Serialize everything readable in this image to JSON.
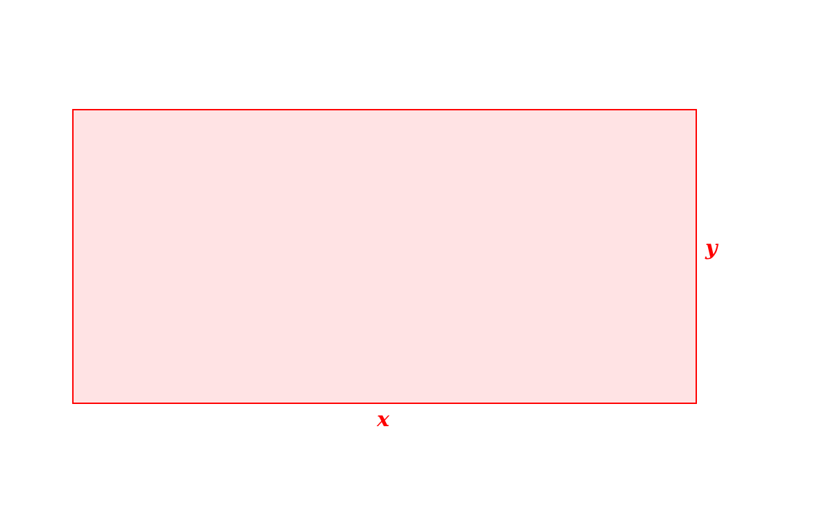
{
  "diagram": {
    "shape": "rectangle",
    "stroke_color": "#ff0000",
    "fill_color": "#ffe3e4",
    "label_color": "#ff0000",
    "labels": {
      "width": "x",
      "height": "y"
    }
  }
}
